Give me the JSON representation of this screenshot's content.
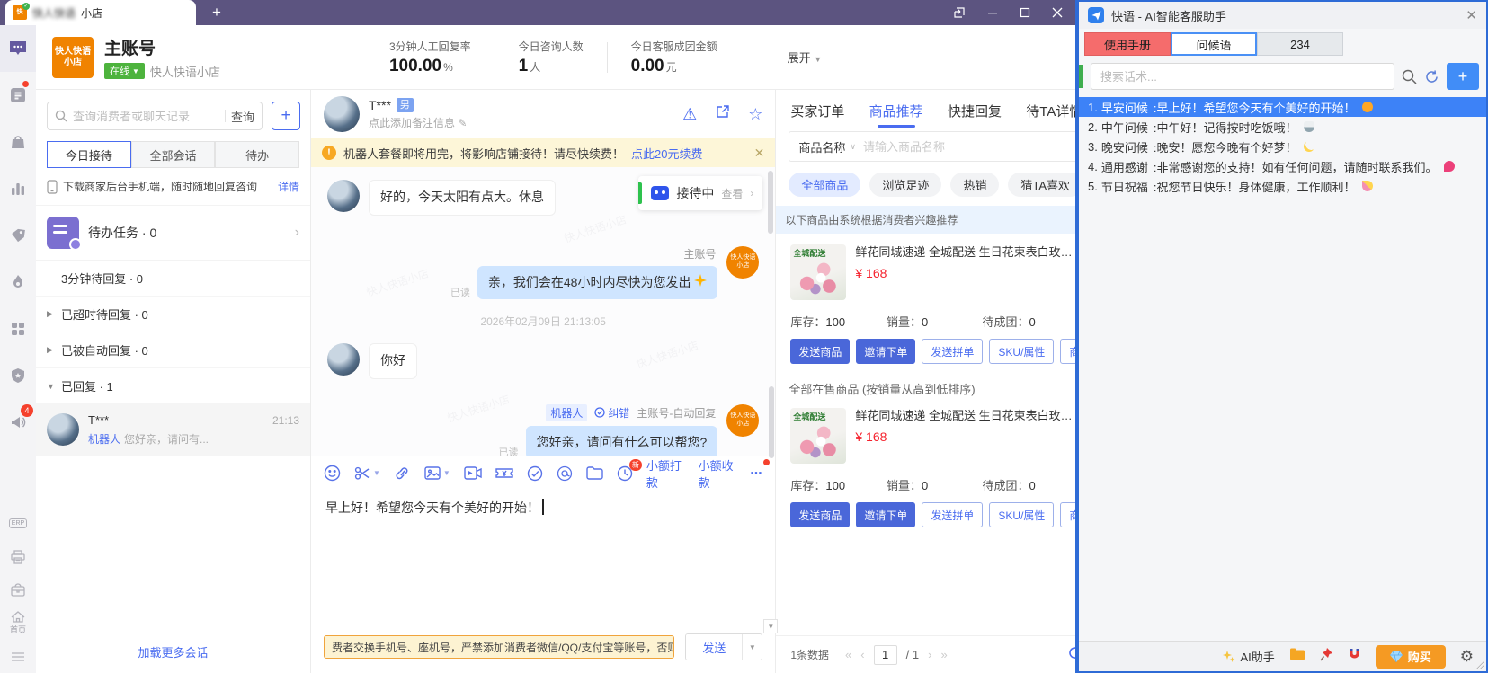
{
  "colors": {
    "accent_blue": "#4a6cf0",
    "titlebar_purple": "#5c5480",
    "ai_selected_blue": "#3d82f7",
    "online_green": "#4db33d",
    "price_red": "#f5222d",
    "buy_orange": "#f59a23",
    "brand_orange": "#f08300"
  },
  "window": {
    "tab_title_blurred": "快人快语",
    "tab_title_clear": "小店"
  },
  "sidebar": {
    "megaphone_badge": "4",
    "erp_label": "ERP",
    "home_label": "首页"
  },
  "header": {
    "logo_line1": "快人快语",
    "logo_line2": "小店",
    "account_name": "主账号",
    "status": "在线",
    "shop_name": "快人快语小店",
    "stats": [
      {
        "label": "3分钟人工回复率",
        "value": "100.00",
        "unit": "%"
      },
      {
        "label": "今日咨询人数",
        "value": "1",
        "unit": "人"
      },
      {
        "label": "今日客服成团金额",
        "value": "0.00",
        "unit": "元"
      }
    ],
    "expand_label": "展开"
  },
  "conversations": {
    "search_placeholder": "查询消费者或聊天记录",
    "search_button": "查询",
    "tabs": [
      "今日接待",
      "全部会话",
      "待办"
    ],
    "download_banner": {
      "text": "下载商家后台手机端，随时随地回复咨询",
      "link": "详情"
    },
    "todo_label": "待办任务 · 0",
    "groups": [
      {
        "label": "3分钟待回复 · 0"
      },
      {
        "label": "已超时待回复 · 0"
      },
      {
        "label": "已被自动回复 · 0"
      },
      {
        "label": "已回复 · 1"
      }
    ],
    "item": {
      "name": "T***",
      "time": "21:13",
      "tag": "机器人",
      "preview": "您好亲，请问有..."
    },
    "load_more": "加载更多会话"
  },
  "chat": {
    "peer_name": "T***",
    "peer_gender": "男",
    "note_placeholder": "点此添加备注信息",
    "edit_icon": "✎",
    "renew_banner": {
      "text": "机器人套餐即将用完，将影响店铺接待！请尽快续费！",
      "link": "点此20元续费"
    },
    "reception": {
      "status": "接待中",
      "action": "查看"
    },
    "messages": [
      {
        "side": "left",
        "text": "好的，今天太阳有点大。休息"
      },
      {
        "side": "right",
        "text": "亲，我们会在48小时内尽快为您发出"
      },
      {
        "side": "left",
        "text": "你好"
      },
      {
        "side": "right",
        "text": "您好亲，请问有什么可以帮您?"
      }
    ],
    "sender_label": "主账号",
    "read_label": "已读",
    "timestamp": "2026年02月09日 21:13:05",
    "auto_badges": {
      "robot": "机器人",
      "correct": "纠错",
      "source": "主账号-自动回复"
    },
    "tools": {
      "small_pay": "小额打款",
      "small_collect": "小额收款",
      "new_badge": "新",
      "more": "⋯"
    },
    "input_text": "早上好！希望您今天有个美好的开始！",
    "security_warning": "费者交换手机号、座机号，严禁添加消费者微信/QQ/支付宝等账号，否则",
    "send_button": "发送"
  },
  "products": {
    "tabs": [
      "买家订单",
      "商品推荐",
      "快捷回复",
      "待TA详情"
    ],
    "filter": {
      "field": "商品名称",
      "placeholder": "请输入商品名称"
    },
    "chips": [
      "全部商品",
      "浏览足迹",
      "热销",
      "猜TA喜欢"
    ],
    "recommend_note": "以下商品由系统根据消费者兴趣推荐",
    "section2_title": "全部在售商品 (按销量从高到低排序)",
    "card": {
      "badge": "全城配送",
      "title": "鲜花同城速递 全城配送 生日花束表白玫瑰 节日...",
      "price": "¥ 168",
      "stats": [
        {
          "label": "库存：",
          "value": "100"
        },
        {
          "label": "销量：",
          "value": "0"
        },
        {
          "label": "待成团：",
          "value": "0"
        }
      ],
      "buttons": [
        "发送商品",
        "邀请下单",
        "发送拼单",
        "SKU/属性",
        "商品评价"
      ]
    },
    "footer": {
      "count": "1条数据",
      "first": "«",
      "prev": "‹",
      "page": "1",
      "total": "/ 1",
      "next": "›",
      "last": "»"
    }
  },
  "ai": {
    "title": "快语 - AI智能客服助手",
    "tabs": [
      {
        "label": "使用手册"
      },
      {
        "label": "问候语"
      },
      {
        "label": "234"
      }
    ],
    "search_placeholder": "搜索话术...",
    "items": [
      {
        "num": "1.",
        "name": "早安问候",
        "text": ":早上好！希望您今天有个美好的开始！",
        "emoji": "sun"
      },
      {
        "num": "2.",
        "name": "中午问候",
        "text": ":中午好！记得按时吃饭哦！",
        "emoji": "rice"
      },
      {
        "num": "3.",
        "name": "晚安问候",
        "text": ":晚安！愿您今晚有个好梦！",
        "emoji": "moon"
      },
      {
        "num": "4.",
        "name": "通用感谢",
        "text": ":非常感谢您的支持！如有任何问题，请随时联系我们。",
        "emoji": "rose"
      },
      {
        "num": "5.",
        "name": "节日祝福",
        "text": ":祝您节日快乐！身体健康，工作顺利！",
        "emoji": "party"
      }
    ],
    "footer": {
      "ai_label": "AI助手",
      "buy_label": "购买"
    }
  },
  "watermark": "快人快语小店"
}
